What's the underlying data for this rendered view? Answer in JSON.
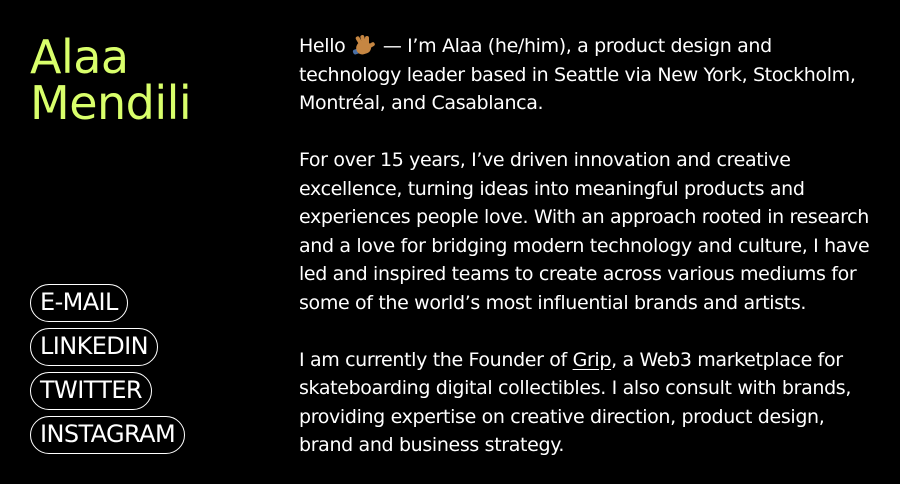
{
  "profile": {
    "first_name": "Alaa",
    "last_name": "Mendili",
    "accent_color": "#d9ff6b"
  },
  "links": [
    {
      "label": "E-MAIL"
    },
    {
      "label": "LINKEDIN"
    },
    {
      "label": "TWITTER"
    },
    {
      "label": "INSTAGRAM"
    }
  ],
  "bio": {
    "p1_greeting": "Hello",
    "p1_wave_icon": "waving-hand-icon",
    "p1_rest": "— I’m Alaa (he/him), a product design and technology leader based in Seattle via New York, Stockholm, Montréal, and Casablanca.",
    "p2": "For over 15 years, I’ve driven innovation and creative excellence, turning ideas into meaningful products and experiences people love. With an approach rooted in research and a love for bridging modern technology and culture, I have led and inspired teams to create across various mediums for some of the world’s most influential brands and artists.",
    "p3_before": "I am currently the Founder of",
    "p3_link": "Grip",
    "p3_after": ", a Web3 marketplace for skateboarding digital collectibles. I also consult with brands, providing expertise on creative direction, product design, brand and business strategy."
  }
}
